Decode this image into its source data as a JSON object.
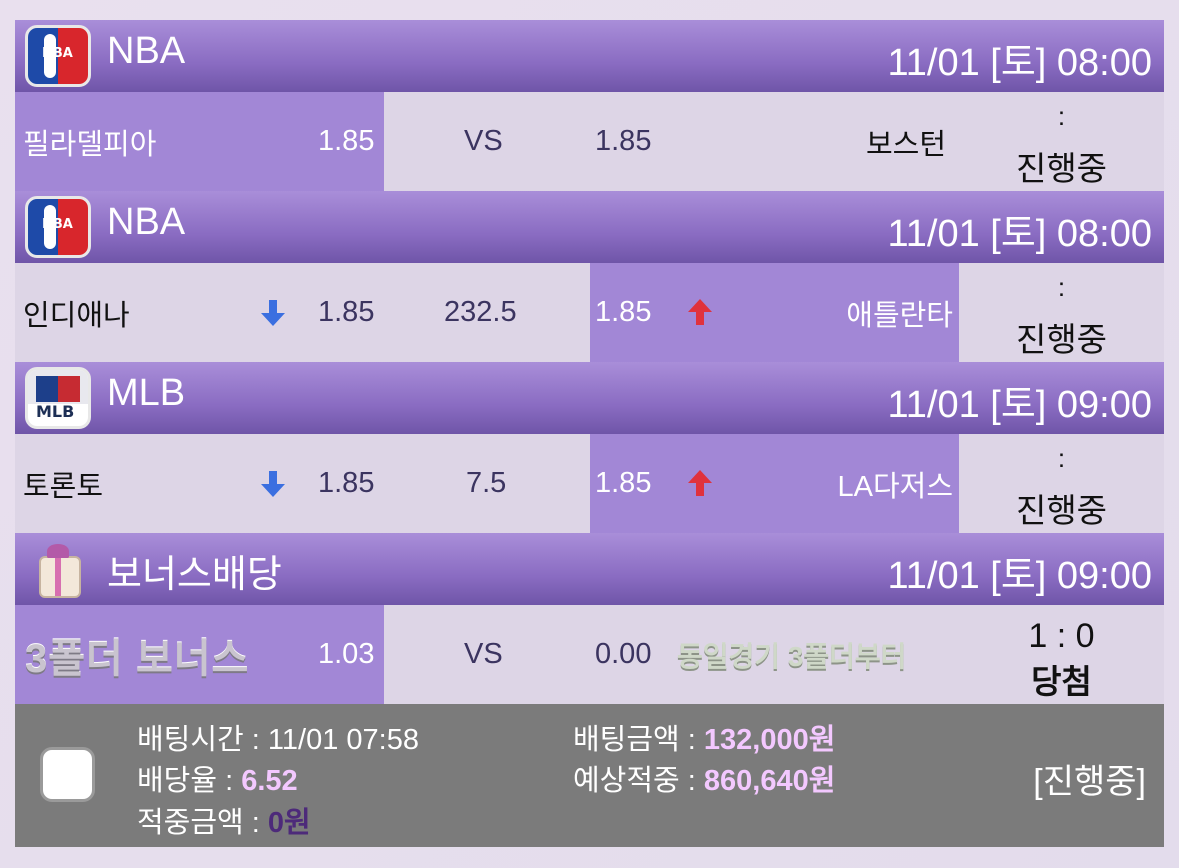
{
  "games": [
    {
      "header": {
        "league": "NBA",
        "logo_icon": "nba-logo-icon",
        "datetime": "11/01 [토] 08:00"
      },
      "home": "필라델피아",
      "home_odds": "1.85",
      "middle": "VS",
      "away_odds": "1.85",
      "away": "보스턴",
      "home_arrow": "",
      "away_arrow": "",
      "score": ":",
      "status": "진행중"
    },
    {
      "header": {
        "league": "NBA",
        "logo_icon": "nba-logo-icon",
        "datetime": "11/01 [토] 08:00"
      },
      "home": "인디애나",
      "home_odds": "1.85",
      "middle": "232.5",
      "away_odds": "1.85",
      "away": "애틀란타",
      "home_arrow": "down-arrow-icon",
      "away_arrow": "up-arrow-icon",
      "score": ":",
      "status": "진행중"
    },
    {
      "header": {
        "league": "MLB",
        "logo_icon": "mlb-logo-icon",
        "datetime": "11/01 [토] 09:00"
      },
      "home": "토론토",
      "home_odds": "1.85",
      "middle": "7.5",
      "away_odds": "1.85",
      "away": "LA다저스",
      "home_arrow": "down-arrow-icon",
      "away_arrow": "up-arrow-icon",
      "score": ":",
      "status": "진행중"
    },
    {
      "header": {
        "league": "보너스배당",
        "logo_icon": "gift-box-icon",
        "datetime": "11/01 [토] 09:00"
      },
      "home": "3폴더 보너스",
      "home_odds": "1.03",
      "middle": "VS",
      "away_odds": "0.00",
      "away": "동일경기 3폴더부터",
      "score": "1 : 0",
      "status": "당첨"
    }
  ],
  "footer": {
    "bet_time_label": "배팅시간 : ",
    "bet_time": "11/01 07:58",
    "odds_label": "배당율 : ",
    "odds": "6.52",
    "win_amount_label": "적중금액 : ",
    "win_amount": "0원",
    "bet_amount_label": "배팅금액 : ",
    "bet_amount": "132,000원",
    "expected_label": "예상적중 : ",
    "expected": "860,640원",
    "status": "[진행중]"
  },
  "colors": {
    "header_purple": "#8a6cc2",
    "highlight_purple": "#a287d6",
    "row_bg": "#ddd5e6",
    "down_arrow": "#3b6fe0",
    "up_arrow": "#e0323c",
    "footer_bg": "#7b7b7b",
    "footer_value": "#f3c8ff"
  }
}
